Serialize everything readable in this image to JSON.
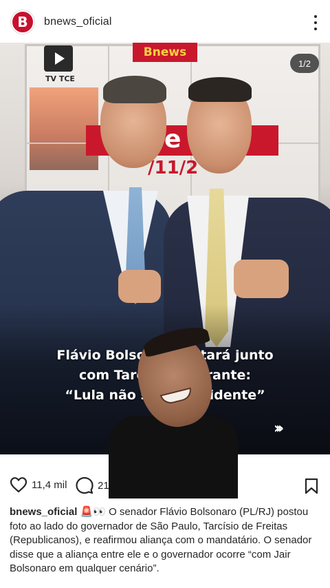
{
  "header": {
    "avatar_letter": "B",
    "username": "bnews_oficial"
  },
  "media": {
    "counter": "1/2",
    "brand_badge": "Bnews",
    "tv_logo": "TV TCE",
    "screen_band_text": "e Se",
    "screen_date_text": "/11/2",
    "headline_lines": [
      "Flávio Bolsonaro estará junto",
      "com Tarcísio e garante:",
      "“Lula não será presidente”"
    ],
    "next_chevrons": "›››"
  },
  "actions": {
    "likes": "11,4 mil",
    "comments": "21",
    "icons": [
      "heart-icon",
      "comment-icon",
      "bookmark-icon"
    ]
  },
  "caption": {
    "username": "bnews_oficial",
    "emojis": "🚨👀",
    "text": "O senador Flávio Bolsonaro (PL/RJ) postou foto ao lado do governador de São Paulo, Tarcísio de Freitas (Republicanos), e reafirmou aliança com o mandatário. O senador disse que a aliança entre ele e o governador ocorre “com Jair Bolsonaro em qualquer cenário”."
  },
  "colors": {
    "brand_red": "#c8102e",
    "brand_yellow": "#f7d044",
    "text": "#262626"
  }
}
